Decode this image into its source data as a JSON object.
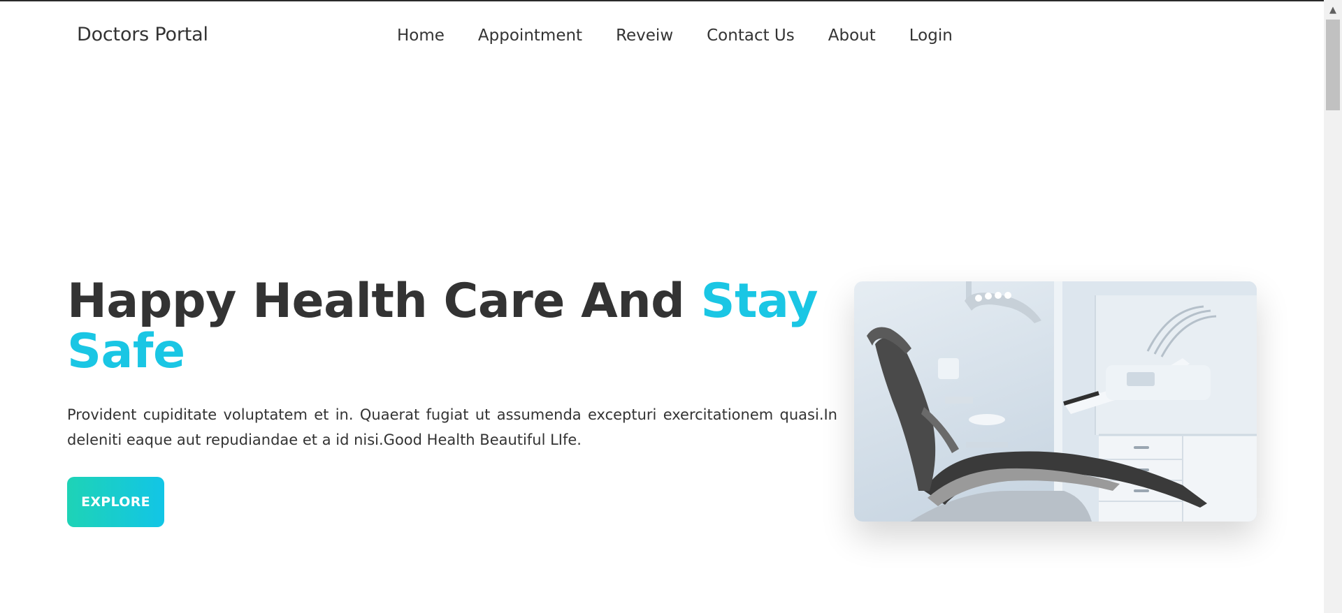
{
  "navbar": {
    "brand": "Doctors Portal",
    "links": [
      "Home",
      "Appointment",
      "Reveiw",
      "Contact Us",
      "About",
      "Login"
    ]
  },
  "hero": {
    "title_main": "Happy Health Care And ",
    "title_accent": "Stay Safe",
    "description": "Provident cupiditate voluptatem et in. Quaerat fugiat ut assumenda excepturi exercitationem quasi.In deleniti eaque aut repudiandae et a id nisi.Good Health Beautiful LIfe.",
    "button_label": "EXPLORE",
    "image_subject": "dental-chair-photo"
  },
  "colors": {
    "accent": "#1ac6e4",
    "button_gradient_start": "#1ed3b6",
    "button_gradient_end": "#12c5e6",
    "text": "#333333"
  },
  "scrollbar": {
    "up_icon": "chevron-up-icon"
  }
}
